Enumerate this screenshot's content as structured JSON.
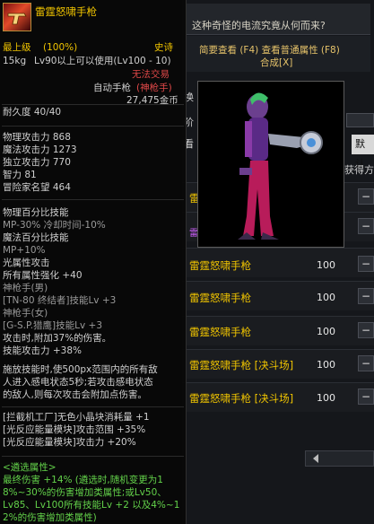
{
  "background": {
    "question": "这种奇怪的电流究竟从何而来?",
    "tip_line1": "简要查看 (F4) 查看普通属性 (F8)",
    "tip_line2": "合成[X]",
    "frag_tab": "换",
    "frag_label": "阶",
    "frag_search": "默认",
    "frag_obtain": "获得方",
    "frag_icon_char": "看",
    "rows": [
      {
        "name": "雷霆怒啸手枪",
        "qty": "100",
        "btn": "−"
      },
      {
        "name": "雷霆怒啸手枪",
        "qty": "100",
        "btn": "−"
      },
      {
        "name": "雷霆怒啸手枪",
        "qty": "100",
        "btn": "−"
      },
      {
        "name": "雷霆怒啸手枪 [决斗场]",
        "qty": "100",
        "btn": "−"
      },
      {
        "name": "雷霆怒啸手枪 [决斗场]",
        "qty": "100",
        "btn": "−"
      }
    ],
    "partial_row1": "雷",
    "partial_row2": "雷霆 [决斗]"
  },
  "tooltip": {
    "name": "雷霆怒啸手枪",
    "grade": "最上级",
    "grade_pct": "(100%)",
    "rarity": "史诗",
    "weight": "15kg",
    "level_req": "Lv90以上可以使用(Lv100 - 10)",
    "trade": "无法交易",
    "type": "自动手枪",
    "job": "(神枪手)",
    "price": "27,475金币",
    "durability": "耐久度 40/40",
    "stats": [
      "物理攻击力 868",
      "魔法攻击力 1273",
      "独立攻击力 770",
      "智力 81",
      "冒险家名望 464"
    ],
    "skills": [
      {
        "text": "物理百分比技能",
        "c": "w"
      },
      {
        "text": " MP-30% 冷却时间-10%",
        "c": "g"
      },
      {
        "text": "魔法百分比技能",
        "c": "w"
      },
      {
        "text": " MP+10%",
        "c": "g"
      },
      {
        "text": "光属性攻击",
        "c": "w"
      },
      {
        "text": "所有属性强化 +40",
        "c": "w"
      },
      {
        "text": "神枪手(男)",
        "c": "g"
      },
      {
        "text": "[TN-80 终结者]技能Lv +3",
        "c": "g"
      },
      {
        "text": "神枪手(女)",
        "c": "g"
      },
      {
        "text": "[G-S.P.猎鹰]技能Lv +3",
        "c": "g"
      },
      {
        "text": "攻击时,附加37%的伤害。",
        "c": "w"
      },
      {
        "text": "技能攻击力 +38%",
        "c": "w"
      }
    ],
    "effect": [
      "施放技能时,使500px范围内的所有敌",
      "人进入感电状态5秒;若攻击感电状态",
      "的敌人,则每次攻击会附加点伤害。"
    ],
    "set_effects": [
      "[拦截机工厂]无色小晶块消耗量 +1",
      "[光反应能量模块]攻击范围 +35%",
      "[光反应能量模块]攻击力 +20%"
    ],
    "select_title": "<遴选属性>",
    "select_lines": [
      "最终伤害 +14% (遴选时,随机变更为1",
      "8%~30%的伤害增加类属性;或Lv50、",
      "Lv85、Lv100所有技能Lv +2 以及4%~1",
      "2%的伤害增加类属性)"
    ]
  }
}
